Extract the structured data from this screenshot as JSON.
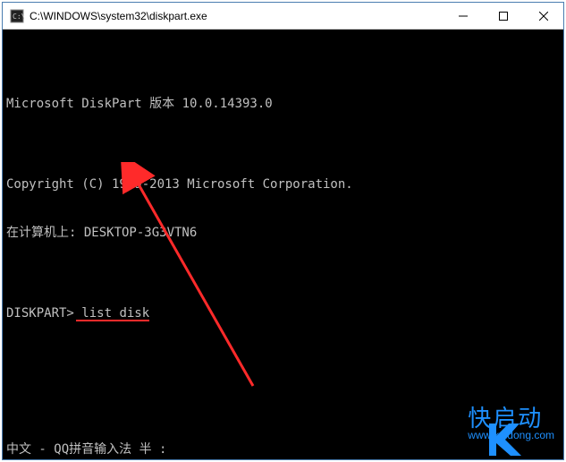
{
  "window": {
    "title": "C:\\WINDOWS\\system32\\diskpart.exe"
  },
  "terminal": {
    "line_blank": "",
    "line_version": "Microsoft DiskPart 版本 10.0.14393.0",
    "line_copyright": "Copyright (C) 1999-2013 Microsoft Corporation.",
    "line_computer": "在计算机上: DESKTOP-3G3VTN6",
    "prompt": "DISKPART> ",
    "command": "list disk",
    "ime": "中文 - QQ拼音输入法 半 :"
  },
  "watermark": {
    "brand": "快启动",
    "url": "www.kqidong.com"
  },
  "colors": {
    "accent_blue": "#1e90ff",
    "arrow_red": "#ff2a2a",
    "term_fg": "#c0c0c0"
  }
}
